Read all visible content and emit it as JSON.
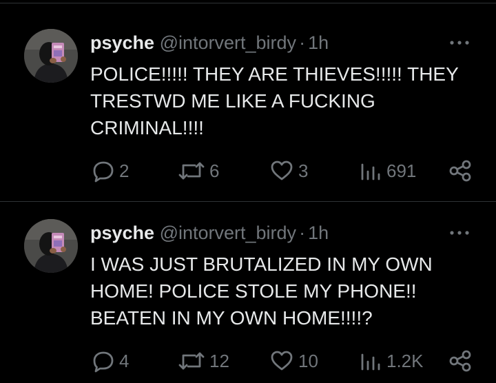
{
  "colors": {
    "background": "#000000",
    "text_primary": "#e7e9ea",
    "text_secondary": "#71767b",
    "divider": "#2f3336"
  },
  "tweets": [
    {
      "author": {
        "display_name": "psyche",
        "handle": "@intorvert_birdy",
        "avatar": "avatar-photo"
      },
      "separator": "·",
      "time": "1h",
      "more_icon": "more-dots-icon",
      "text": "POLICE!!!!! THEY ARE THIEVES!!!!! THEY\nTRESTWD ME LIKE A FUCKING\nCRIMINAL!!!!",
      "stats": {
        "replies": "2",
        "retweets": "6",
        "likes": "3",
        "views": "691"
      }
    },
    {
      "author": {
        "display_name": "psyche",
        "handle": "@intorvert_birdy",
        "avatar": "avatar-photo"
      },
      "separator": "·",
      "time": "1h",
      "more_icon": "more-dots-icon",
      "text": "I WAS JUST BRUTALIZED IN MY OWN\nHOME! POLICE STOLE MY PHONE!!\nBEATEN IN MY OWN HOME!!!!?",
      "stats": {
        "replies": "4",
        "retweets": "12",
        "likes": "10",
        "views": "1.2K"
      }
    }
  ]
}
